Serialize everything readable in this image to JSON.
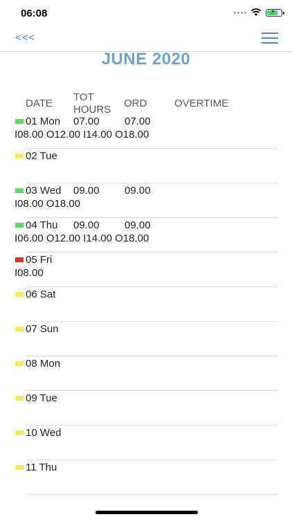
{
  "status": {
    "time": "06:08"
  },
  "nav": {
    "back_label": "<<<",
    "menu_icon": "hamburger-menu-icon"
  },
  "title": "JUNE 2020",
  "columns": {
    "date": "DATE",
    "tot_line1": "TOT",
    "tot_line2": "HOURS",
    "ord": "ORD",
    "overtime": "OVERTIME"
  },
  "colors": {
    "green": "#5fdc5f",
    "yellow": "#f3ec5a",
    "red": "#d8332a",
    "accent": "#6aa2d4"
  },
  "days": [
    {
      "label": "01 Mon",
      "status": "green",
      "tot": "07.00",
      "ord": "07.00",
      "punches": "I08.00 O12.00 I14.00 O18.00"
    },
    {
      "label": "02 Tue",
      "status": "yellow",
      "tot": "",
      "ord": "",
      "punches": ""
    },
    {
      "label": "03 Wed",
      "status": "green",
      "tot": "09.00",
      "ord": "09.00",
      "punches": "I08.00 O18.00"
    },
    {
      "label": "04 Thu",
      "status": "green",
      "tot": "09.00",
      "ord": "09.00",
      "punches": "I06.00 O12.00 I14.00 O18.00"
    },
    {
      "label": "05 Fri",
      "status": "red",
      "tot": "",
      "ord": "",
      "punches": "I08.00"
    },
    {
      "label": "06 Sat",
      "status": "yellow",
      "tot": "",
      "ord": "",
      "punches": ""
    },
    {
      "label": "07 Sun",
      "status": "yellow",
      "tot": "",
      "ord": "",
      "punches": ""
    },
    {
      "label": "08 Mon",
      "status": "yellow",
      "tot": "",
      "ord": "",
      "punches": ""
    },
    {
      "label": "09 Tue",
      "status": "yellow",
      "tot": "",
      "ord": "",
      "punches": ""
    },
    {
      "label": "10 Wed",
      "status": "yellow",
      "tot": "",
      "ord": "",
      "punches": ""
    },
    {
      "label": "11 Thu",
      "status": "yellow",
      "tot": "",
      "ord": "",
      "punches": ""
    }
  ]
}
